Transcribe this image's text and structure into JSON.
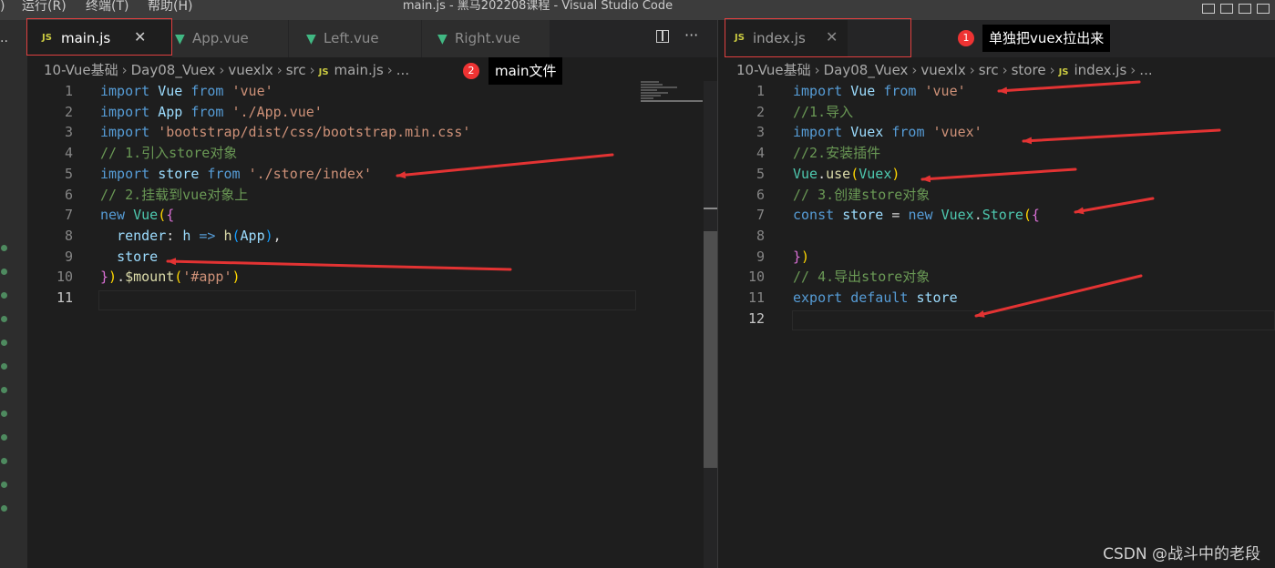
{
  "window": {
    "title": "main.js - 黑马202208课程 - Visual Studio Code",
    "menu": [
      ")",
      "运行(R)",
      "终端(T)",
      "帮助(H)"
    ]
  },
  "left_group": {
    "tabs": [
      {
        "label": "main.js",
        "icon": "JS",
        "active": true,
        "close": "✕"
      },
      {
        "label": "App.vue",
        "icon": "vue-icon",
        "active": false
      },
      {
        "label": "Left.vue",
        "icon": "vue-icon",
        "active": false
      },
      {
        "label": "Right.vue",
        "icon": "vue-icon",
        "active": false
      }
    ],
    "actions": {
      "split": "split-editor-icon",
      "more": "···"
    },
    "breadcrumb": [
      "10-Vue基础",
      "Day08_Vuex",
      "vuexlx",
      "src",
      "main.js",
      "..."
    ],
    "line_numbers": [
      "1",
      "2",
      "3",
      "4",
      "5",
      "6",
      "7",
      "8",
      "9",
      "10",
      "11"
    ],
    "current_line": "11",
    "code": [
      [
        [
          "kw",
          "import"
        ],
        [
          "pl",
          " "
        ],
        [
          "var",
          "Vue"
        ],
        [
          "pl",
          " "
        ],
        [
          "kw",
          "from"
        ],
        [
          "pl",
          " "
        ],
        [
          "str",
          "'vue'"
        ]
      ],
      [
        [
          "kw",
          "import"
        ],
        [
          "pl",
          " "
        ],
        [
          "var",
          "App"
        ],
        [
          "pl",
          " "
        ],
        [
          "kw",
          "from"
        ],
        [
          "pl",
          " "
        ],
        [
          "str",
          "'./App.vue'"
        ]
      ],
      [
        [
          "kw",
          "import"
        ],
        [
          "pl",
          " "
        ],
        [
          "str",
          "'bootstrap/dist/css/bootstrap.min.css'"
        ]
      ],
      [
        [
          "cmt",
          "// 1.引入store对象"
        ]
      ],
      [
        [
          "kw",
          "import"
        ],
        [
          "pl",
          " "
        ],
        [
          "var",
          "store"
        ],
        [
          "pl",
          " "
        ],
        [
          "kw",
          "from"
        ],
        [
          "pl",
          " "
        ],
        [
          "str",
          "'./store/index'"
        ]
      ],
      [
        [
          "cmt",
          "// 2.挂载到vue对象上"
        ]
      ],
      [
        [
          "kw",
          "new"
        ],
        [
          "pl",
          " "
        ],
        [
          "cls",
          "Vue"
        ],
        [
          "br1",
          "("
        ],
        [
          "br2",
          "{"
        ]
      ],
      [
        [
          "pl",
          "  "
        ],
        [
          "var",
          "render"
        ],
        [
          "pl",
          ": "
        ],
        [
          "var",
          "h"
        ],
        [
          "pl",
          " "
        ],
        [
          "kw",
          "=>"
        ],
        [
          "pl",
          " "
        ],
        [
          "fn",
          "h"
        ],
        [
          "br3",
          "("
        ],
        [
          "var",
          "App"
        ],
        [
          "br3",
          ")"
        ],
        [
          "pl",
          ","
        ]
      ],
      [
        [
          "pl",
          "  "
        ],
        [
          "var",
          "store"
        ]
      ],
      [
        [
          "br2",
          "}"
        ],
        [
          "br1",
          ")"
        ],
        [
          "pl",
          "."
        ],
        [
          "fn",
          "$mount"
        ],
        [
          "br1",
          "("
        ],
        [
          "str",
          "'#app'"
        ],
        [
          "br1",
          ")"
        ]
      ],
      []
    ]
  },
  "right_group": {
    "tabs": [
      {
        "label": "index.js",
        "icon": "JS",
        "active": true,
        "close": "✕"
      }
    ],
    "breadcrumb": [
      "10-Vue基础",
      "Day08_Vuex",
      "vuexlx",
      "src",
      "store",
      "index.js",
      "..."
    ],
    "line_numbers": [
      "1",
      "2",
      "3",
      "4",
      "5",
      "6",
      "7",
      "8",
      "9",
      "10",
      "11",
      "12"
    ],
    "current_line": "12",
    "code": [
      [
        [
          "kw",
          "import"
        ],
        [
          "pl",
          " "
        ],
        [
          "var",
          "Vue"
        ],
        [
          "pl",
          " "
        ],
        [
          "kw",
          "from"
        ],
        [
          "pl",
          " "
        ],
        [
          "str",
          "'vue'"
        ]
      ],
      [
        [
          "cmt",
          "//1.导入"
        ]
      ],
      [
        [
          "kw",
          "import"
        ],
        [
          "pl",
          " "
        ],
        [
          "var",
          "Vuex"
        ],
        [
          "pl",
          " "
        ],
        [
          "kw",
          "from"
        ],
        [
          "pl",
          " "
        ],
        [
          "str",
          "'vuex'"
        ]
      ],
      [
        [
          "cmt",
          "//2.安装插件"
        ]
      ],
      [
        [
          "cls",
          "Vue"
        ],
        [
          "pl",
          "."
        ],
        [
          "fn",
          "use"
        ],
        [
          "br1",
          "("
        ],
        [
          "cls",
          "Vuex"
        ],
        [
          "br1",
          ")"
        ]
      ],
      [
        [
          "cmt",
          "// 3.创建store对象"
        ]
      ],
      [
        [
          "kw",
          "const"
        ],
        [
          "pl",
          " "
        ],
        [
          "var",
          "store"
        ],
        [
          "pl",
          " = "
        ],
        [
          "kw",
          "new"
        ],
        [
          "pl",
          " "
        ],
        [
          "cls",
          "Vuex"
        ],
        [
          "pl",
          "."
        ],
        [
          "cls",
          "Store"
        ],
        [
          "br1",
          "("
        ],
        [
          "br2",
          "{"
        ]
      ],
      [],
      [
        [
          "br2",
          "}"
        ],
        [
          "br1",
          ")"
        ]
      ],
      [
        [
          "cmt",
          "// 4.导出store对象"
        ]
      ],
      [
        [
          "kw",
          "export"
        ],
        [
          "pl",
          " "
        ],
        [
          "kw",
          "default"
        ],
        [
          "pl",
          " "
        ],
        [
          "var",
          "store"
        ]
      ],
      []
    ]
  },
  "annotations": [
    {
      "number": "1",
      "text": "单独把vuex拉出来"
    },
    {
      "number": "2",
      "text": "main文件"
    }
  ],
  "watermark": "CSDN @战斗中的老段",
  "colors": {
    "annotation_red": "#e33333",
    "keyword": "#569cd6",
    "string": "#ce9178",
    "comment": "#6a9955"
  }
}
